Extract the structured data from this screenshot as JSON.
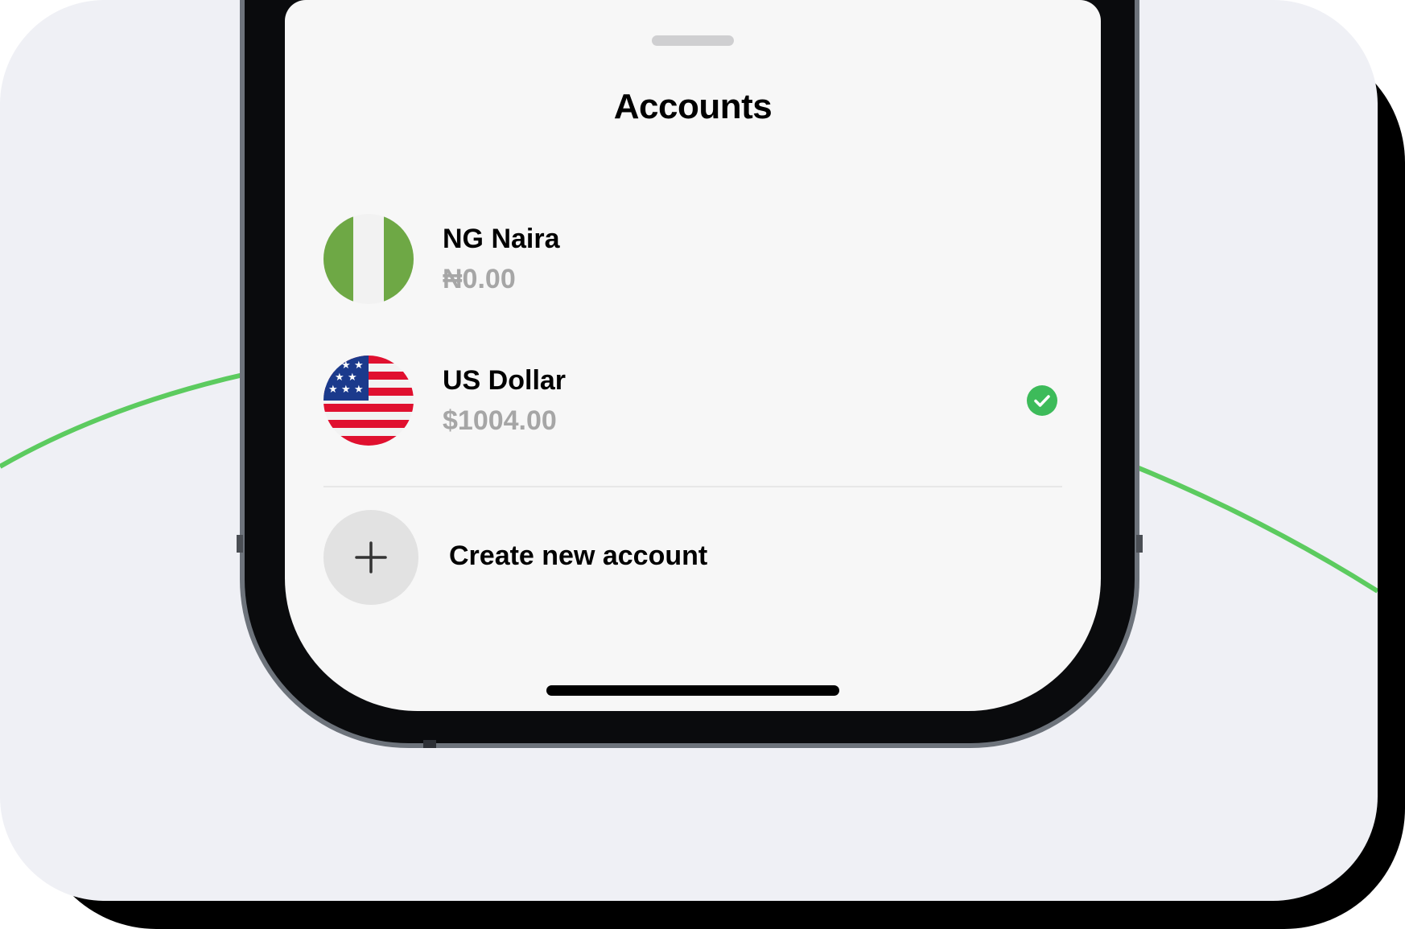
{
  "sheet": {
    "title": "Accounts"
  },
  "accounts": [
    {
      "name": "NG Naira",
      "balance": "₦0.00",
      "flag": "nigeria-flag",
      "selected": false
    },
    {
      "name": "US Dollar",
      "balance": "$1004.00",
      "flag": "us-flag",
      "selected": true
    }
  ],
  "create": {
    "label": "Create new account",
    "icon": "plus-icon"
  },
  "colors": {
    "accent_green": "#3dbb5a",
    "curve_green": "#5ccb5f",
    "background": "#eff0f5",
    "muted_text": "#a6a6a6"
  }
}
